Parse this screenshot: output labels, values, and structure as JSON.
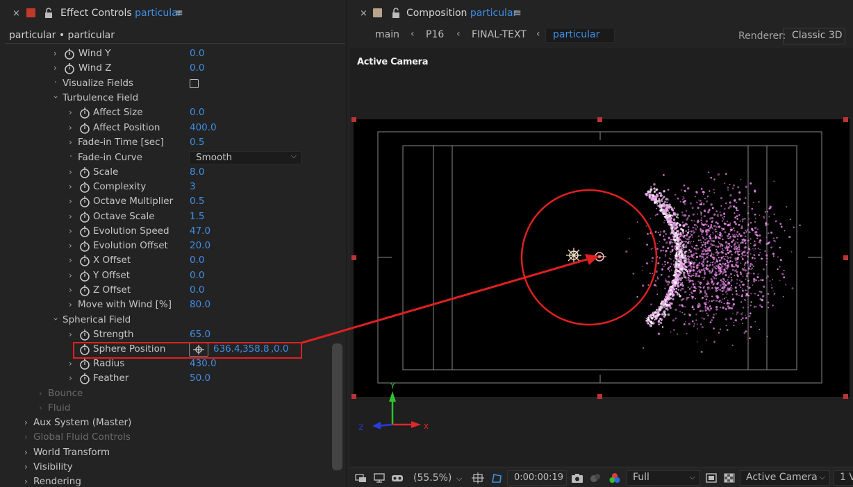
{
  "effect_controls": {
    "close": "×",
    "title": "Effect Controls",
    "layer": "particular",
    "menu": "≡",
    "breadcrumb": "particular • particular",
    "rows": [
      {
        "label": "Wind Y",
        "value": "0.0"
      },
      {
        "label": "Wind Z",
        "value": "0.0"
      },
      {
        "label": "Visualize Fields"
      },
      {
        "label": "Turbulence Field"
      },
      {
        "label": "Affect Size",
        "value": "0.0"
      },
      {
        "label": "Affect Position",
        "value": "400.0"
      },
      {
        "label": "Fade-in Time [sec]",
        "value": "0.5"
      },
      {
        "label": "Fade-in Curve",
        "value": "Smooth"
      },
      {
        "label": "Scale",
        "value": "8.0"
      },
      {
        "label": "Complexity",
        "value": "3"
      },
      {
        "label": "Octave Multiplier",
        "value": "0.5"
      },
      {
        "label": "Octave Scale",
        "value": "1.5"
      },
      {
        "label": "Evolution Speed",
        "value": "47.0"
      },
      {
        "label": "Evolution Offset",
        "value": "20.0"
      },
      {
        "label": "X Offset",
        "value": "0.0"
      },
      {
        "label": "Y Offset",
        "value": "0.0"
      },
      {
        "label": "Z Offset",
        "value": "0.0"
      },
      {
        "label": "Move with Wind [%]",
        "value": "80.0"
      },
      {
        "label": "Spherical Field"
      },
      {
        "label": "Strength",
        "value": "65.0"
      },
      {
        "label": "Sphere Position",
        "x": "636.4",
        "y": "358.8",
        "z": "0.0"
      },
      {
        "label": "Radius",
        "value": "430.0"
      },
      {
        "label": "Feather",
        "value": "50.0"
      },
      {
        "label": "Bounce"
      },
      {
        "label": "Fluid"
      },
      {
        "label": "Aux System (Master)"
      },
      {
        "label": "Global Fluid Controls"
      },
      {
        "label": "World Transform"
      },
      {
        "label": "Visibility"
      },
      {
        "label": "Rendering"
      }
    ]
  },
  "composition": {
    "close": "×",
    "title": "Composition",
    "name": "particular",
    "menu": "≡",
    "breadcrumbs": [
      "main",
      "P16",
      "FINAL-TEXT",
      "particular"
    ],
    "crumb_separator": "‹",
    "renderer_label": "Renderer:",
    "renderer_value": "Classic 3D",
    "view_label": "Active Camera",
    "axis_labels": {
      "x": "x",
      "y": "Y",
      "z": "Z"
    },
    "colors": {
      "highlight": "#e02020",
      "particles": "#e88ae8",
      "accent": "#3f8fe6"
    }
  },
  "viewer_toolbar": {
    "magnification": "(55.5%)",
    "timecode": "0:00:00:19",
    "resolution": "Full",
    "camera": "Active Camera",
    "views": "1 V",
    "chevron": "⌵"
  }
}
